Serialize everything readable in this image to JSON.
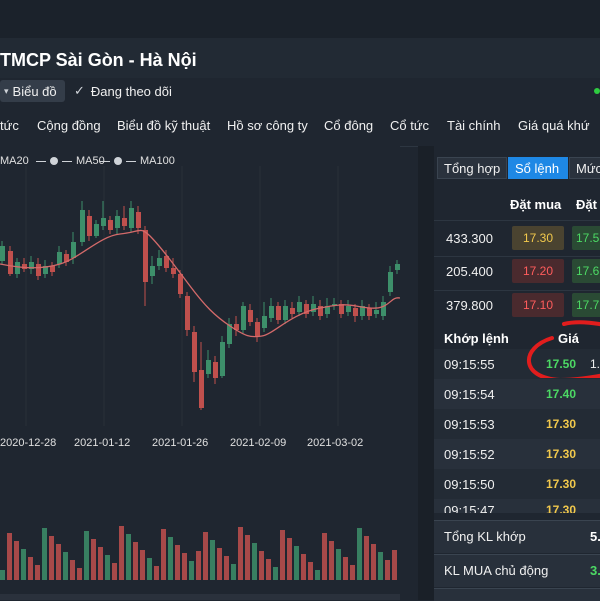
{
  "header": {
    "title": "TMCP Sài Gòn - Hà Nội",
    "chart_button": "Biểu đồ",
    "follow_button": "Đang theo dõi"
  },
  "nav": [
    "tức",
    "Cộng đồng",
    "Biểu đồ kỹ thuật",
    "Hồ sơ công ty",
    "Cổ đông",
    "Cổ tức",
    "Tài chính",
    "Giá quá khứ"
  ],
  "legend": [
    "MA20",
    "MA50",
    "MA100"
  ],
  "chart_data": {
    "type": "candlestick",
    "x_tick_labels": [
      "2020-12-28",
      "2021-01-12",
      "2021-01-26",
      "2021-02-09",
      "2021-03-02"
    ],
    "series_names": [
      "MA20",
      "MA50",
      "MA100"
    ],
    "colors": {
      "up": "#3d8f6a",
      "down": "#c0504d",
      "ma": "#d46a6a"
    }
  },
  "right_panel": {
    "tabs": [
      "Tổng hợp",
      "Sổ lệnh",
      "Mức"
    ],
    "orderbook": {
      "col_buy": "Đặt mua",
      "col_next": "Đặt",
      "rows": [
        {
          "volume": "433.300",
          "price": "17.30",
          "price_color": "#f2c94c",
          "price_bg": "#4a4330",
          "next": "17.5",
          "next_color": "#4cd964",
          "next_bg": "#2a4a34"
        },
        {
          "volume": "205.400",
          "price": "17.20",
          "price_color": "#ff5c5c",
          "price_bg": "#4a2a2e",
          "next": "17.6",
          "next_color": "#4cd964",
          "next_bg": "#2a4a34"
        },
        {
          "volume": "379.800",
          "price": "17.10",
          "price_color": "#ff5c5c",
          "price_bg": "#4a2a2e",
          "next": "17.7",
          "next_color": "#4cd964",
          "next_bg": "#2a4a34"
        }
      ]
    },
    "matched": {
      "col_time": "Khớp lệnh",
      "col_price": "Giá",
      "rows": [
        {
          "time": "09:15:55",
          "price": "17.50",
          "color": "#4cd964",
          "extra": "1."
        },
        {
          "time": "09:15:54",
          "price": "17.40",
          "color": "#4cd964"
        },
        {
          "time": "09:15:53",
          "price": "17.30",
          "color": "#f2c94c"
        },
        {
          "time": "09:15:52",
          "price": "17.30",
          "color": "#f2c94c"
        },
        {
          "time": "09:15:50",
          "price": "17.30",
          "color": "#f2c94c"
        },
        {
          "time": "09:15:47",
          "price": "17.30",
          "color": "#f2c94c"
        }
      ]
    },
    "summary": [
      {
        "label": "Tổng KL khớp",
        "value": "5.",
        "color": "#ffffff"
      },
      {
        "label": "KL MUA chủ động",
        "value": "3.",
        "color": "#4cd964"
      }
    ]
  }
}
